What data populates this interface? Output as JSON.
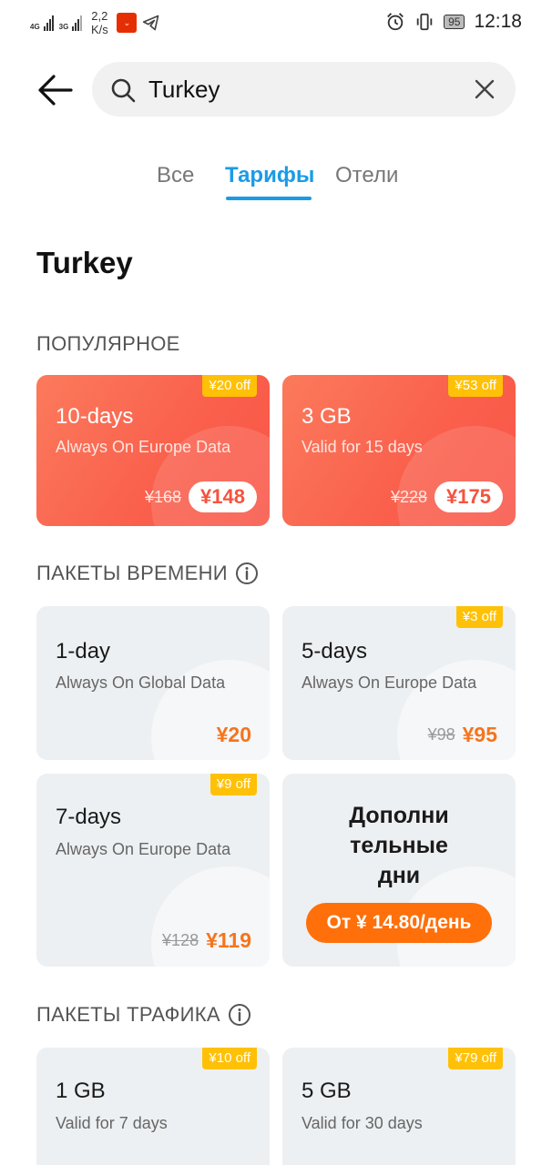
{
  "status_bar": {
    "net1": "4G",
    "net2": "3G",
    "speed_value": "2,2",
    "speed_unit": "K/s",
    "battery": "95",
    "time": "12:18"
  },
  "search": {
    "query": "Turkey"
  },
  "tabs": [
    {
      "label": "Все"
    },
    {
      "label": "Тарифы",
      "active": true
    },
    {
      "label": "Отели"
    }
  ],
  "page_title": "Turkey",
  "sections": {
    "popular": "ПОПУЛЯРНОЕ",
    "time_packages": "ПАКЕТЫ ВРЕМЕНИ",
    "traffic_packages": "ПАКЕТЫ ТРАФИКА"
  },
  "popular": [
    {
      "badge": "¥20 off",
      "title": "10-days",
      "subtitle": "Always On Europe Data",
      "old_price": "¥168",
      "price": "¥148"
    },
    {
      "badge": "¥53 off",
      "title": "3 GB",
      "subtitle": "Valid for 15 days",
      "old_price": "¥228",
      "price": "¥175"
    }
  ],
  "time_packages": [
    {
      "badge": "",
      "title": "1-day",
      "subtitle": "Always On Global Data",
      "old_price": "",
      "price": "¥20"
    },
    {
      "badge": "¥3 off",
      "title": "5-days",
      "subtitle": "Always On Europe Data",
      "old_price": "¥98",
      "price": "¥95"
    },
    {
      "badge": "¥9 off",
      "title": "7-days",
      "subtitle": "Always On Europe Data",
      "old_price": "¥128",
      "price": "¥119"
    }
  ],
  "extra_days": {
    "title_l1": "Дополни",
    "title_l2": "тельные",
    "title_l3": "дни",
    "button": "От ¥ 14.80/день"
  },
  "traffic_packages": [
    {
      "badge": "¥10 off",
      "title": "1 GB",
      "subtitle": "Valid for 7 days"
    },
    {
      "badge": "¥79 off",
      "title": "5 GB",
      "subtitle": "Valid for 30 days"
    }
  ],
  "colors": {
    "accent": "#1a9be6",
    "hot_card": "#fa5f4c",
    "price_orange": "#f6741c",
    "badge": "#ffc107"
  }
}
